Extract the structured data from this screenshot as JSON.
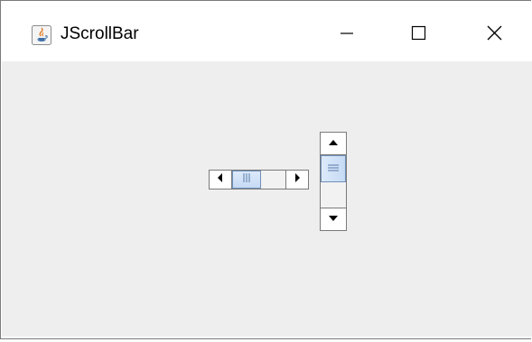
{
  "window": {
    "title": "JScrollBar",
    "icon": "java-coffee-cup-icon",
    "controls": {
      "minimize_icon": "minimize-icon",
      "maximize_icon": "maximize-icon",
      "close_icon": "close-icon"
    }
  },
  "colors": {
    "content_background": "#eeeeee",
    "thumb_fill": "#c6daf4",
    "thumb_border": "#6f8fb9",
    "border": "#7a7a7a"
  },
  "horizontal_scrollbar": {
    "orientation": "horizontal",
    "thumb_position_fraction": 0.0,
    "thumb_extent_fraction": 0.55,
    "left_button_icon": "triangle-left-icon",
    "right_button_icon": "triangle-right-icon",
    "thumb_grip_icon": "vertical-grip-icon"
  },
  "vertical_scrollbar": {
    "orientation": "vertical",
    "thumb_position_fraction": 0.0,
    "thumb_extent_fraction": 0.52,
    "up_button_icon": "triangle-up-icon",
    "down_button_icon": "triangle-down-icon",
    "thumb_grip_icon": "horizontal-grip-icon"
  }
}
